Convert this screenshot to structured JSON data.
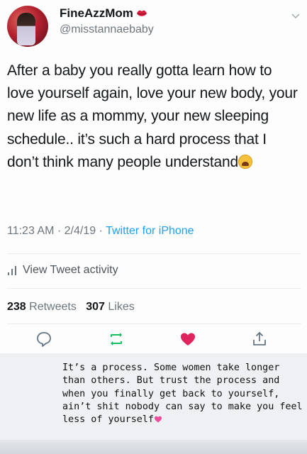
{
  "profile": {
    "display_name": "FineAzzMom",
    "name_emoji_icon": "kiss-lips-icon",
    "handle": "@misstannaebaby"
  },
  "tweet": {
    "text": "After a baby you really gotta learn how to love yourself again, love your new body, your new life as a mommy, your new sleeping schedule.. it’s such a hard process that I don’t think many people understand",
    "end_emoji_icon": "weary-face-icon",
    "time": "11:23 AM",
    "date": "2/4/19",
    "separator": "·",
    "source": "Twitter for iPhone"
  },
  "activity": {
    "label": "View Tweet activity",
    "icon": "bar-chart-icon"
  },
  "stats": {
    "retweets_count": "238",
    "retweets_label": "Retweets",
    "likes_count": "307",
    "likes_label": "Likes"
  },
  "actions": {
    "reply_icon": "reply-icon",
    "retweet_icon": "retweet-icon",
    "like_icon": "heart-icon",
    "share_icon": "share-icon"
  },
  "caption": {
    "text": "It’s a process. Some women take longer than others. But trust the process and when you finally get back to yourself, ain’t shit nobody can say to make you feel less of yourself",
    "end_emoji_icon": "pink-heart-icon"
  },
  "colors": {
    "link_blue": "#1da1f2",
    "retweet_green": "#17bf63",
    "like_red": "#e0245e",
    "secondary_gray": "#6e767d"
  }
}
